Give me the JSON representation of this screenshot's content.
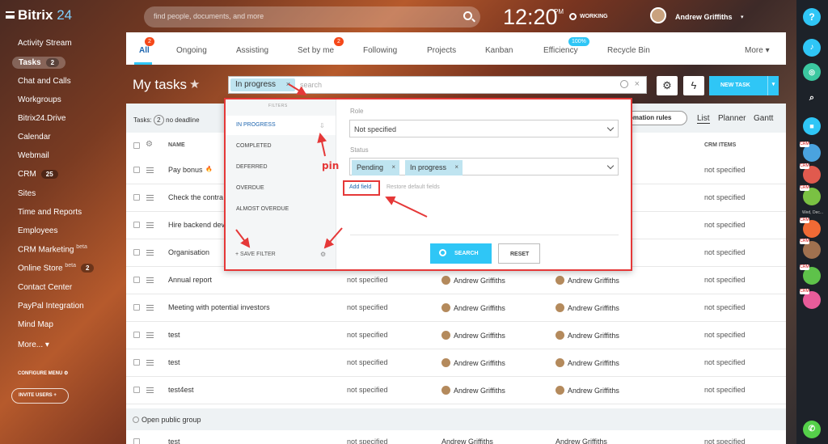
{
  "header": {
    "logo_main": "Bitrix",
    "logo_num": "24",
    "search_placeholder": "find people, documents, and more",
    "time": "12:20",
    "ampm": "PM",
    "work_status": "WORKING",
    "user_name": "Andrew Griffiths"
  },
  "sidebar": {
    "items": [
      {
        "label": "Activity Stream",
        "count": ""
      },
      {
        "label": "Tasks",
        "count": "2"
      },
      {
        "label": "Chat and Calls",
        "count": ""
      },
      {
        "label": "Workgroups",
        "count": ""
      },
      {
        "label": "Bitrix24.Drive",
        "count": ""
      },
      {
        "label": "Calendar",
        "count": ""
      },
      {
        "label": "Webmail",
        "count": ""
      },
      {
        "label": "CRM",
        "count": "25"
      },
      {
        "label": "Sites",
        "count": ""
      },
      {
        "label": "Time and Reports",
        "count": ""
      },
      {
        "label": "Employees",
        "count": ""
      },
      {
        "label": "CRM Marketing",
        "count": "",
        "sup": "beta"
      },
      {
        "label": "Online Store",
        "count": "2",
        "sup": "beta"
      },
      {
        "label": "Contact Center",
        "count": ""
      },
      {
        "label": "PayPal Integration",
        "count": ""
      },
      {
        "label": "Mind Map",
        "count": ""
      },
      {
        "label": "More...",
        "count": ""
      }
    ],
    "configure_menu": "CONFIGURE MENU",
    "invite_users": "INVITE USERS"
  },
  "tabs": [
    {
      "label": "All",
      "badge": "2"
    },
    {
      "label": "Ongoing",
      "badge": ""
    },
    {
      "label": "Assisting",
      "badge": ""
    },
    {
      "label": "Set by me",
      "badge": "2"
    },
    {
      "label": "Following",
      "badge": ""
    },
    {
      "label": "Projects",
      "badge": ""
    },
    {
      "label": "Kanban",
      "badge": ""
    },
    {
      "label": "Efficiency",
      "badge": "100%"
    },
    {
      "label": "Recycle Bin",
      "badge": ""
    },
    {
      "label": "More",
      "badge": ""
    }
  ],
  "page": {
    "title": "My tasks",
    "filter_chip": "In progress",
    "search_placeholder": "search",
    "new_task": "NEW TASK",
    "tasks_label": "Tasks:",
    "tasks_count": "2",
    "no_deadline": "no deadline",
    "automation": "omation rules",
    "views": [
      "List",
      "Planner",
      "Gantt"
    ]
  },
  "table": {
    "headers": {
      "name": "NAME",
      "crm": "CRM ITEMS"
    },
    "rows": [
      {
        "name": "Pay bonus",
        "deadline": "",
        "created_by": "",
        "responsible": "",
        "crm": "not specified"
      },
      {
        "name": "Check the contra",
        "deadline": "",
        "created_by": "",
        "responsible": "",
        "crm": "not specified"
      },
      {
        "name": "Hire backend dev",
        "deadline": "",
        "created_by": "",
        "responsible": "",
        "crm": "not specified"
      },
      {
        "name": "Organisation",
        "deadline": "",
        "created_by": "",
        "responsible": "",
        "crm": "not specified"
      },
      {
        "name": "Annual report",
        "deadline": "not specified",
        "created_by": "Andrew Griffiths",
        "responsible": "Andrew Griffiths",
        "crm": "not specified"
      },
      {
        "name": "Meeting with potential investors",
        "deadline": "not specified",
        "created_by": "Andrew Griffiths",
        "responsible": "Andrew Griffiths",
        "crm": "not specified"
      },
      {
        "name": "test",
        "deadline": "not specified",
        "created_by": "Andrew Griffiths",
        "responsible": "Andrew Griffiths",
        "crm": "not specified"
      },
      {
        "name": "test",
        "deadline": "not specified",
        "created_by": "Andrew Griffiths",
        "responsible": "Andrew Griffiths",
        "crm": "not specified"
      },
      {
        "name": "test4est",
        "deadline": "not specified",
        "created_by": "Andrew Griffiths",
        "responsible": "Andrew Griffiths",
        "crm": "not specified"
      }
    ],
    "group": "Open public group",
    "last_row": {
      "name": "test",
      "deadline": "not specified",
      "created_by": "Andrew Griffiths",
      "responsible": "Andrew Griffiths",
      "crm": "not specified"
    }
  },
  "filter_popup": {
    "title": "FILTERS",
    "presets": [
      "IN PROGRESS",
      "COMPLETED",
      "DEFERRED",
      "OVERDUE",
      "ALMOST OVERDUE"
    ],
    "save_filter": "SAVE FILTER",
    "role_label": "Role",
    "role_value": "Not specified",
    "status_label": "Status",
    "status_chips": [
      "Pending",
      "In progress"
    ],
    "add_field": "Add field",
    "restore": "Restore default fields",
    "search_btn": "SEARCH",
    "reset_btn": "RESET",
    "annotation": "pin"
  },
  "right_panel": {
    "date_label": "Wed, Dec..."
  },
  "colors": {
    "accent": "#2fc6f6",
    "link": "#2067b0",
    "highlight": "#e53838",
    "badge": "#f54819"
  }
}
